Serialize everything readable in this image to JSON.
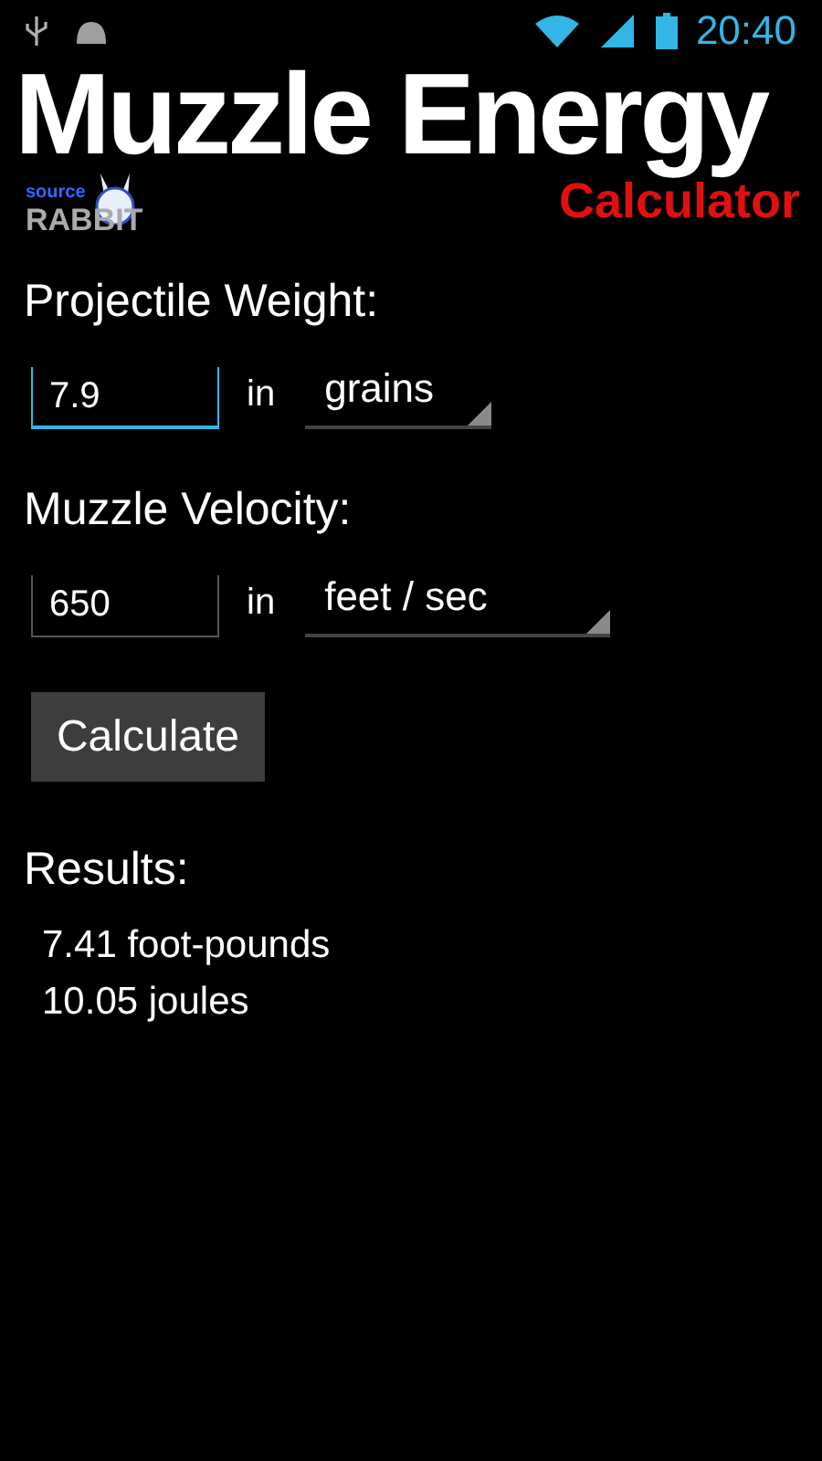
{
  "status_bar": {
    "time": "20:40"
  },
  "header": {
    "title": "Muzzle Energy",
    "subtitle": "Calculator",
    "logo_top": "source",
    "logo_bottom": "RABBIT"
  },
  "fields": [
    {
      "label": "Projectile Weight:",
      "value": "7.9",
      "focused": true,
      "connector": "in",
      "unit": "grains"
    },
    {
      "label": "Muzzle Velocity:",
      "value": "650",
      "focused": false,
      "connector": "in",
      "unit": "feet / sec"
    }
  ],
  "button": "Calculate",
  "results": {
    "heading": "Results:",
    "lines": [
      "7.41 foot-pounds",
      "10.05 joules"
    ]
  }
}
